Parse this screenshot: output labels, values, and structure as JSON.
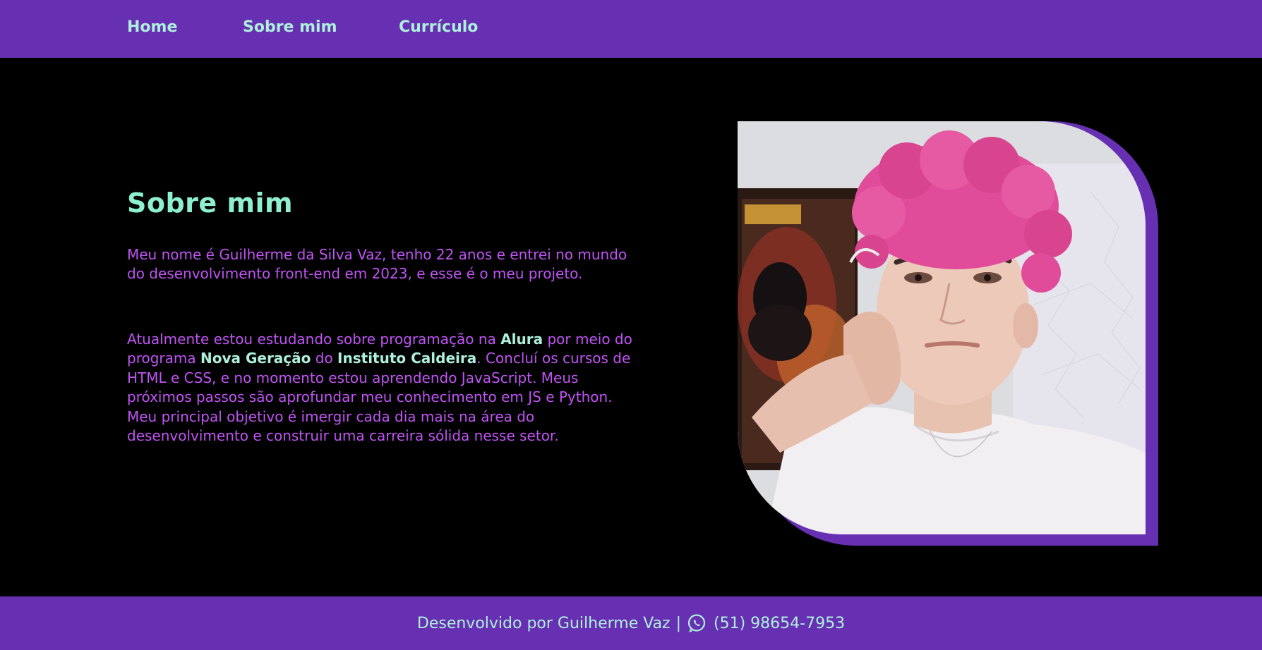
{
  "nav": {
    "home": "Home",
    "about": "Sobre mim",
    "cv": "Currículo"
  },
  "main": {
    "title": "Sobre mim",
    "paragraph1": "Meu nome é Guilherme da Silva Vaz, tenho 22 anos e entrei no mundo do desenvolvimento front-end em 2023, e esse é o meu projeto.",
    "paragraph2": {
      "part1": "Atualmente estou estudando sobre programação na ",
      "highlight1": "Alura",
      "part2": " por meio do programa ",
      "highlight2": "Nova Geração",
      "part3": " do ",
      "highlight3": "Instituto Caldeira",
      "part4": ". Concluí os cursos de HTML e CSS, e no momento estou aprendendo JavaScript. Meus próximos passos são aprofundar meu conhecimento em JS e Python. Meu principal objetivo é imergir cada dia mais na área do desenvolvimento e construir uma carreira sólida nesse setor."
    },
    "photo_icon": "profile-photo"
  },
  "footer": {
    "credit": "Desenvolvido por Guilherme Vaz",
    "separator": "|",
    "icon": "whatsapp-icon",
    "phone": "(51) 98654-7953"
  },
  "colors": {
    "nav_bg": "#6730b2",
    "accent_text": "#aef0dc",
    "title": "#8ff0cf",
    "body_text": "#c154f5",
    "background": "#000000"
  }
}
